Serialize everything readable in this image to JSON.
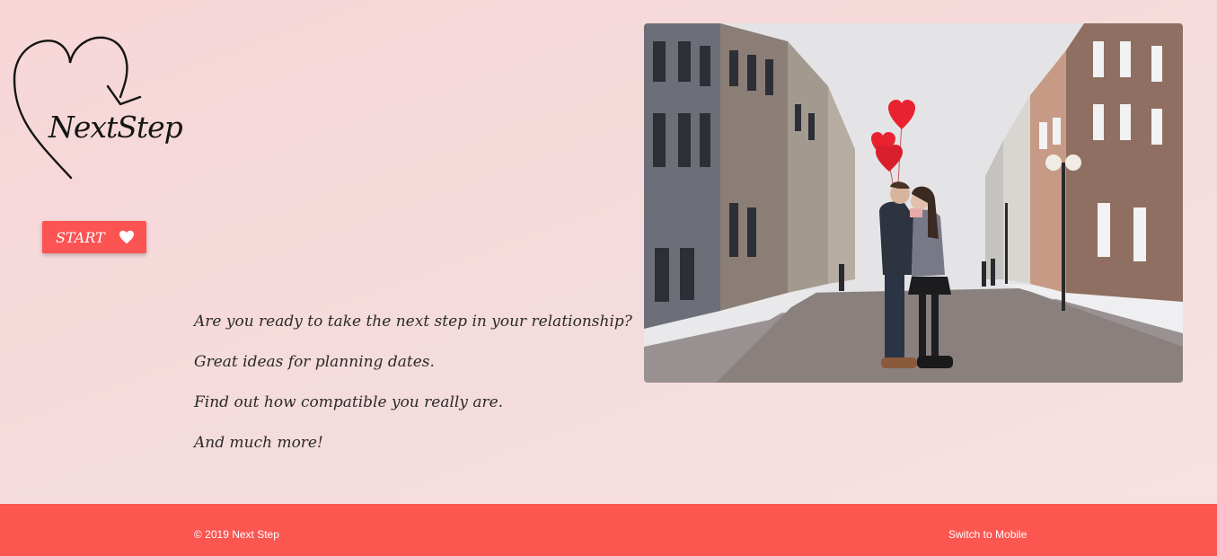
{
  "logo": {
    "text": "NextStep",
    "icon": "heart-arrow-icon"
  },
  "start_button": {
    "label": "START",
    "icon": "heart-icon"
  },
  "intro": {
    "lines": [
      "Are you ready to take the next step in your relationship?",
      "Great ideas for planning dates.",
      "Find out how compatible you really are.",
      "And much more!"
    ]
  },
  "hero": {
    "description_icon": "couple-street-photo"
  },
  "footer": {
    "copyright": "© 2019 Next Step",
    "switch_label": "Switch to Mobile"
  },
  "colors": {
    "accent": "#fc5650",
    "background": "#f7d9d9",
    "text": "#2a2a2a"
  }
}
